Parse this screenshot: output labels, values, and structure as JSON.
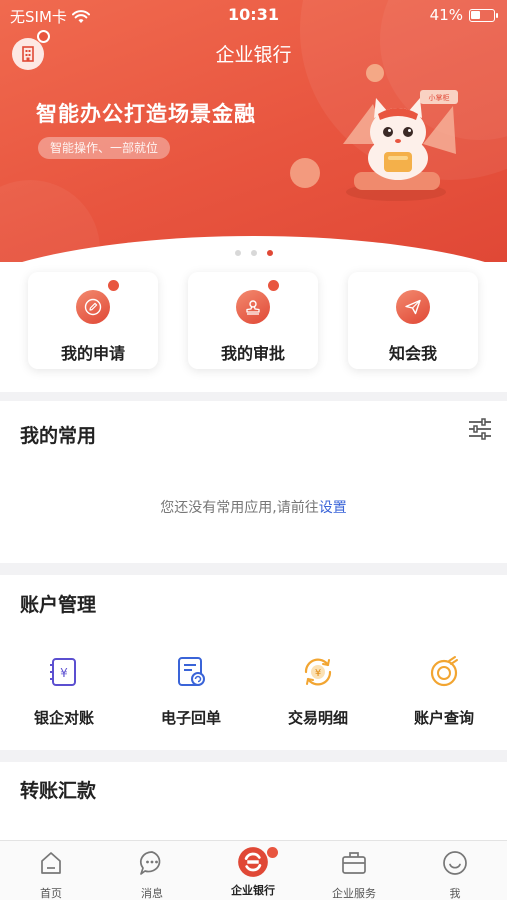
{
  "status_bar": {
    "carrier": "无SIM卡",
    "time": "10:31",
    "battery": "41%",
    "battery_level": 0.41
  },
  "header": {
    "title": "企业银行"
  },
  "banner": {
    "headline": "智能办公打造场景金融",
    "subtitle": "智能操作、一部就位",
    "pager_count": 3,
    "pager_active": 3
  },
  "quick_actions": [
    {
      "label": "我的申请",
      "icon": "pen-icon",
      "badge": true
    },
    {
      "label": "我的审批",
      "icon": "stamp-icon",
      "badge": true
    },
    {
      "label": "知会我",
      "icon": "paper-plane-icon",
      "badge": false
    }
  ],
  "favorites": {
    "title": "我的常用",
    "empty_text": "您还没有常用应用,请前往",
    "empty_link": "设置"
  },
  "account": {
    "title": "账户管理",
    "items": [
      {
        "label": "银企对账",
        "icon": "yen-document-icon"
      },
      {
        "label": "电子回单",
        "icon": "receipt-icon"
      },
      {
        "label": "交易明细",
        "icon": "yen-coin-icon"
      },
      {
        "label": "账户查询",
        "icon": "account-search-icon"
      }
    ]
  },
  "transfer": {
    "title": "转账汇款"
  },
  "tabbar": {
    "items": [
      {
        "label": "首页",
        "icon": "home-icon"
      },
      {
        "label": "消息",
        "icon": "message-icon"
      },
      {
        "label": "企业银行",
        "icon": "bank-logo-icon",
        "active": true,
        "badge": true
      },
      {
        "label": "企业服务",
        "icon": "briefcase-icon"
      },
      {
        "label": "我",
        "icon": "smiley-icon"
      }
    ]
  },
  "colors": {
    "brand": "#e04836",
    "accent_purple": "#5b4fd0",
    "accent_blue": "#3a64d8",
    "accent_orange": "#f2a531",
    "link": "#3a64d8"
  }
}
